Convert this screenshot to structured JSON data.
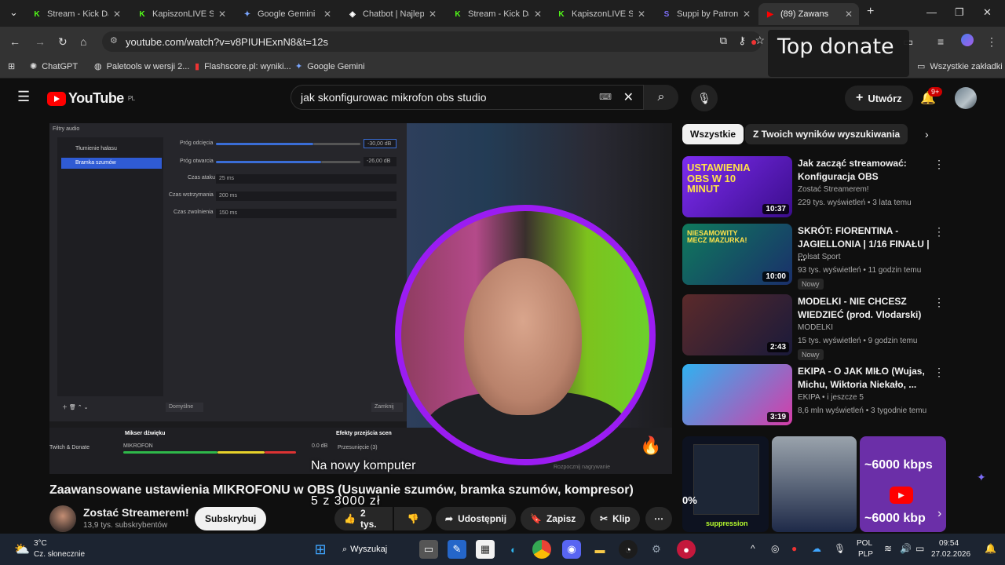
{
  "browser": {
    "tabs": [
      {
        "title": "Stream - Kick Da",
        "icon": "kick-icon",
        "color": "#53fc18"
      },
      {
        "title": "KapiszonLIVE Str",
        "icon": "kick-icon",
        "color": "#53fc18"
      },
      {
        "title": "Google Gemini",
        "icon": "gemini-icon",
        "color": "#7aa6ff"
      },
      {
        "title": "Chatbot | Najlep",
        "icon": "chatbot-icon",
        "color": "#ffffff"
      },
      {
        "title": "Stream - Kick Da",
        "icon": "kick-icon",
        "color": "#53fc18"
      },
      {
        "title": "KapiszonLIVE Str",
        "icon": "kick-icon",
        "color": "#53fc18"
      },
      {
        "title": "Suppi by Patron",
        "icon": "suppi-icon",
        "color": "#7b6cf5"
      },
      {
        "title": "(89) Zawans",
        "icon": "youtube-icon",
        "color": "#ff0000",
        "active": true
      }
    ],
    "url": "youtube.com/watch?v=v8PIUHExnN8&t=12s",
    "bookmarks": [
      "ChatGPT",
      "Paletools w wersji 2...",
      "Flashscore.pl: wyniki...",
      "Google Gemini"
    ],
    "all_bookmarks": "Wszystkie zakładki",
    "overlay_text": "Top donate"
  },
  "youtube": {
    "logo": "YouTube",
    "region": "PL",
    "search_query": "jak skonfigurowac mikrofon obs studio",
    "create_label": "Utwórz",
    "notif_count": "9+"
  },
  "video": {
    "obs": {
      "panel_title": "Filtry audio",
      "filters": [
        "Tłumienie hałasu",
        "Bramka szumów"
      ],
      "labels": [
        "Próg odcięcia",
        "Próg otwarcia",
        "Czas ataku",
        "Czas wstrzymania",
        "Czas zwolnienia"
      ],
      "values": [
        "-30,00 dB",
        "-26,00 dB",
        "25 ms",
        "200 ms",
        "150 ms"
      ],
      "buttons": [
        "Domyślne",
        "Zamknij"
      ],
      "mixer_title": "Mikser dźwięku",
      "transitions_title": "Efekty przejścia scen",
      "mic_label": "MIKROFON",
      "mic_db": "0.0 dB",
      "twitch_label": "Twitch & Donate",
      "transition_label": "Przesunięcie (3)",
      "record_label": "Rozpocznij nagrywanie"
    },
    "caption_line1": "Na nowy komputer",
    "caption_line2": "5 z 3000 zł",
    "title": "Zaawansowane ustawienia MIKROFONU w OBS (Usuwanie szumów, bramka szumów, kompresor)",
    "channel": "Zostać Streamerem!",
    "subscribers": "13,9 tys. subskrybentów",
    "subscribe_label": "Subskrybuj",
    "likes": "2 tys.",
    "share_label": "Udostępnij",
    "save_label": "Zapisz",
    "clip_label": "Klip"
  },
  "sidebar": {
    "chips": [
      "Wszystkie",
      "Z Twoich wyników wyszukiwania"
    ],
    "recommendations": [
      {
        "title": "Jak zacząć streamować: Konfiguracja OBS",
        "channel": "Zostać Streamerem!",
        "meta": "229 tys. wyświetleń • 3 lata temu",
        "duration": "10:37",
        "badge": ""
      },
      {
        "title": "SKRÓT: FIORENTINA - JAGIELLONIA | 1/16 FINAŁU | ...",
        "channel": "Polsat Sport",
        "meta": "93 tys. wyświetleń • 11 godzin temu",
        "duration": "10:00",
        "badge": "Nowy"
      },
      {
        "title": "MODELKI - NIE CHCESZ WIEDZIEĆ (prod. Vlodarski)",
        "channel": "MODELKI",
        "meta": "15 tys. wyświetleń • 9 godzin temu",
        "duration": "2:43",
        "badge": "Nowy"
      },
      {
        "title": "EKIPA - O JAK MIŁO (Wujas, Michu, Wiktoria Niekało, ...",
        "channel": "EKIPA • i jeszcze 5",
        "meta": "8,6 mln wyświetleń • 3 tygodnie temu",
        "duration": "3:19",
        "badge": ""
      }
    ],
    "thumb_text1": "USTAWIENIA OBS W 10 MINUT",
    "thumb_text2": "NIESAMOWITY MECZ MAZURKA!",
    "shelf_pct": "0%",
    "shelf_label": "suppression",
    "shelf_kbps1": "~6000 kbps",
    "shelf_kbps2": "~6000 kbp"
  },
  "taskbar": {
    "weather_temp": "3°C",
    "weather_desc": "Cz. słonecznie",
    "search_label": "Wyszukaj",
    "lang1": "POL",
    "lang2": "PLP",
    "time": "09:54",
    "date": "27.02.2026"
  }
}
